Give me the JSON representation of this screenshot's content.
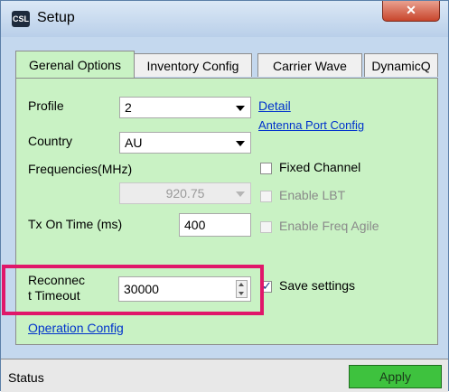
{
  "window": {
    "title": "Setup",
    "close_label": "✕"
  },
  "tabs": [
    {
      "label": "Gerenal Options",
      "active": true
    },
    {
      "label": "Inventory Config",
      "active": false
    },
    {
      "label": "Carrier Wave",
      "active": false
    },
    {
      "label": "DynamicQ",
      "active": false
    }
  ],
  "general": {
    "profile_label": "Profile",
    "profile_value": "2",
    "country_label": "Country",
    "country_value": "AU",
    "frequencies_label": "Frequencies(MHz)",
    "frequency_value": "920.75",
    "tx_on_time_label": "Tx On Time (ms)",
    "tx_on_time_value": "400",
    "reconnect_label_1": "Reconnec",
    "reconnect_label_2": "t Timeout",
    "reconnect_value": "30000",
    "operation_config_link": "Operation Config",
    "detail_link": "Detail",
    "antenna_port_link": "Antenna Port Config",
    "fixed_channel_label": "Fixed Channel",
    "enable_lbt_label": "Enable LBT",
    "enable_freq_agile_label": "Enable Freq Agile",
    "save_settings_label": "Save settings",
    "save_settings_checked": true
  },
  "status": {
    "text": "Status",
    "apply_label": "Apply"
  },
  "colors": {
    "panel": "#c9f2c4",
    "highlight": "#e0176a",
    "apply": "#3ec23e",
    "link": "#0033cc"
  }
}
